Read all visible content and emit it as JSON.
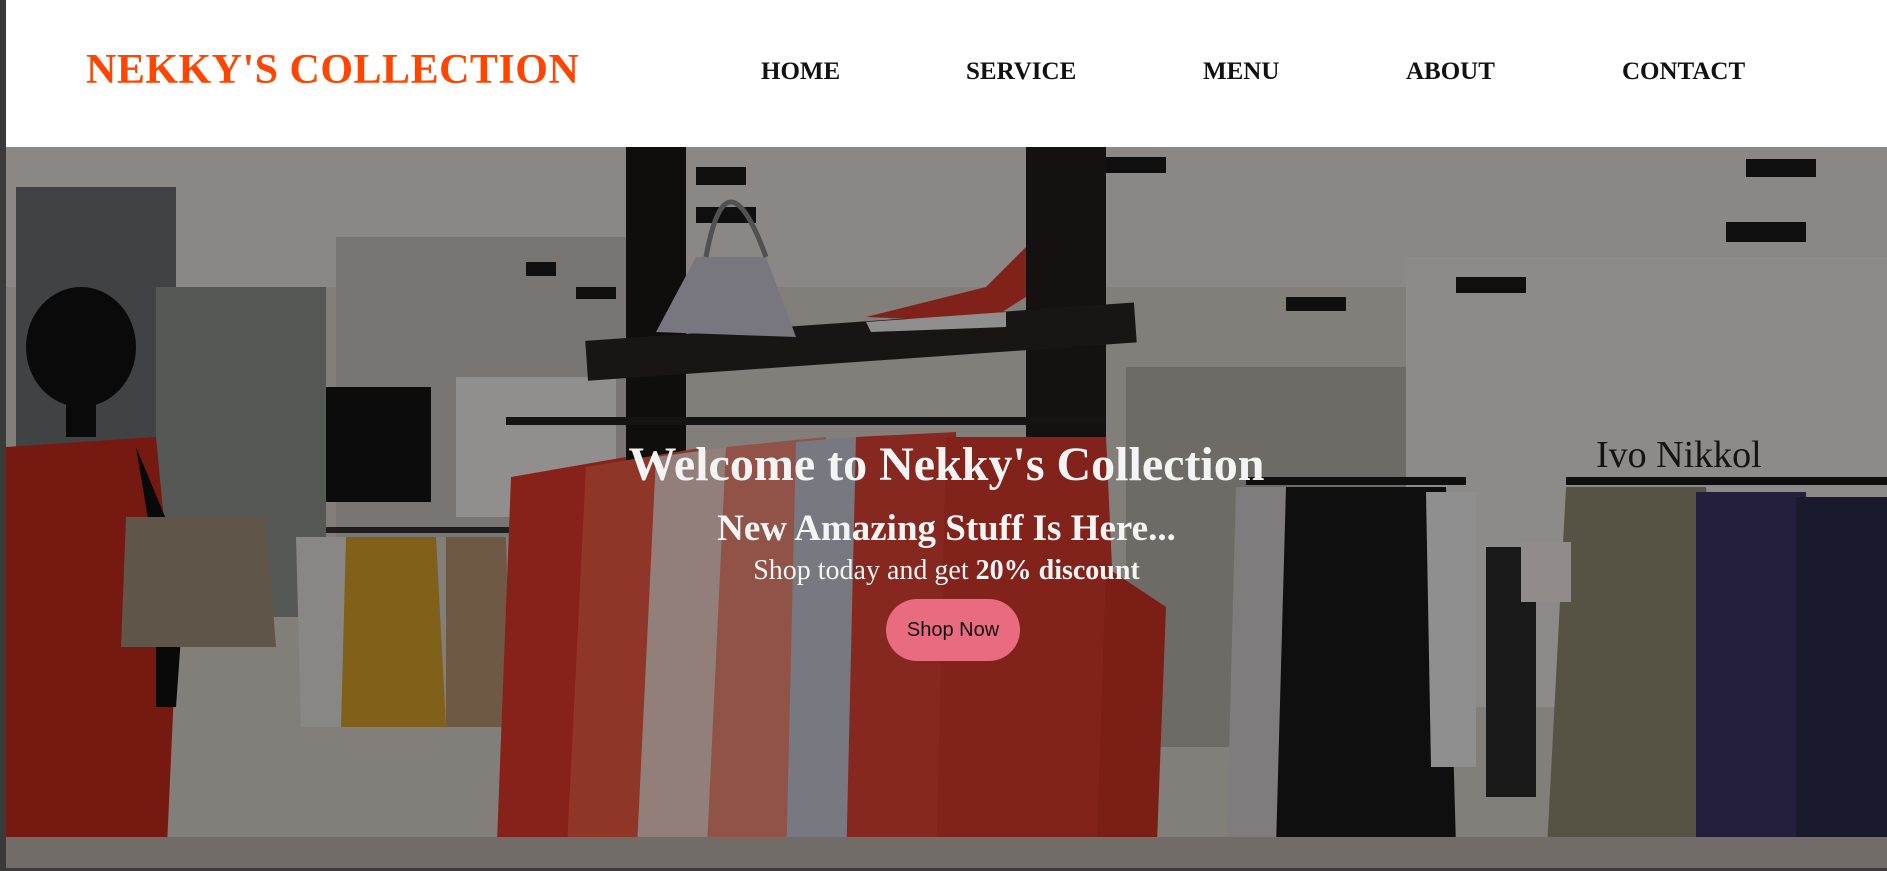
{
  "header": {
    "brand": "NEKKY'S COLLECTION",
    "nav": [
      "HOME",
      "SERVICE",
      "MENU",
      "ABOUT",
      "CONTACT"
    ]
  },
  "hero": {
    "title": "Welcome to Nekky's Collection",
    "subtitle": "New Amazing Stuff Is Here...",
    "promo_prefix": "Shop today and get ",
    "promo_bold": "20% discount",
    "button_label": "Shop Now",
    "store_sign": "Ivo Nikkol"
  },
  "colors": {
    "brand": "#ff4500",
    "button": "#e86b80"
  }
}
